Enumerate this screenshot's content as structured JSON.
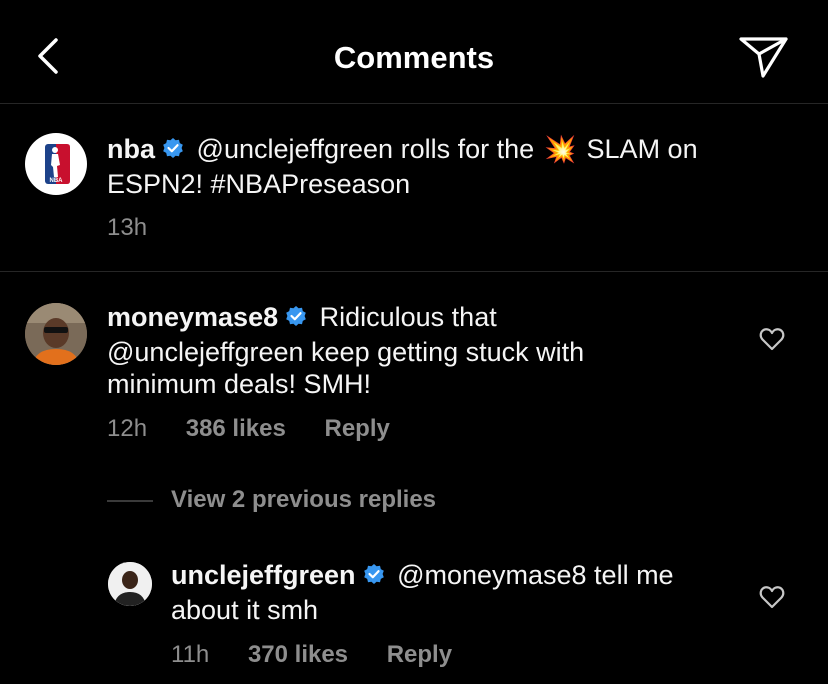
{
  "header": {
    "title": "Comments",
    "back_icon": "chevron-left-icon",
    "send_icon": "paper-plane-icon"
  },
  "caption": {
    "username": "nba",
    "mention": "@unclejeffgreen",
    "text_before_emoji": "rolls for the",
    "emoji": "💥",
    "text_after_emoji": "SLAM on",
    "text_line2": "ESPN2! #NBAPreseason",
    "time": "13h"
  },
  "comment": {
    "username": "moneymase8",
    "text_line1": "Ridiculous that",
    "text_line2": "@unclejeffgreen keep getting stuck with",
    "text_line3": "minimum deals! SMH!",
    "time": "12h",
    "likes": "386 likes",
    "reply": "Reply"
  },
  "view_replies": "View 2 previous replies",
  "reply": {
    "username": "unclejeffgreen",
    "text_line1": "@moneymase8 tell me",
    "text_line2": "about it smh",
    "time": "11h",
    "likes": "370 likes",
    "reply": "Reply"
  },
  "colors": {
    "background": "#000000",
    "text": "#f5f5f5",
    "muted": "#8e8e8e",
    "verified": "#3897f0",
    "nba_blue": "#1d428a",
    "nba_red": "#c8102e"
  }
}
